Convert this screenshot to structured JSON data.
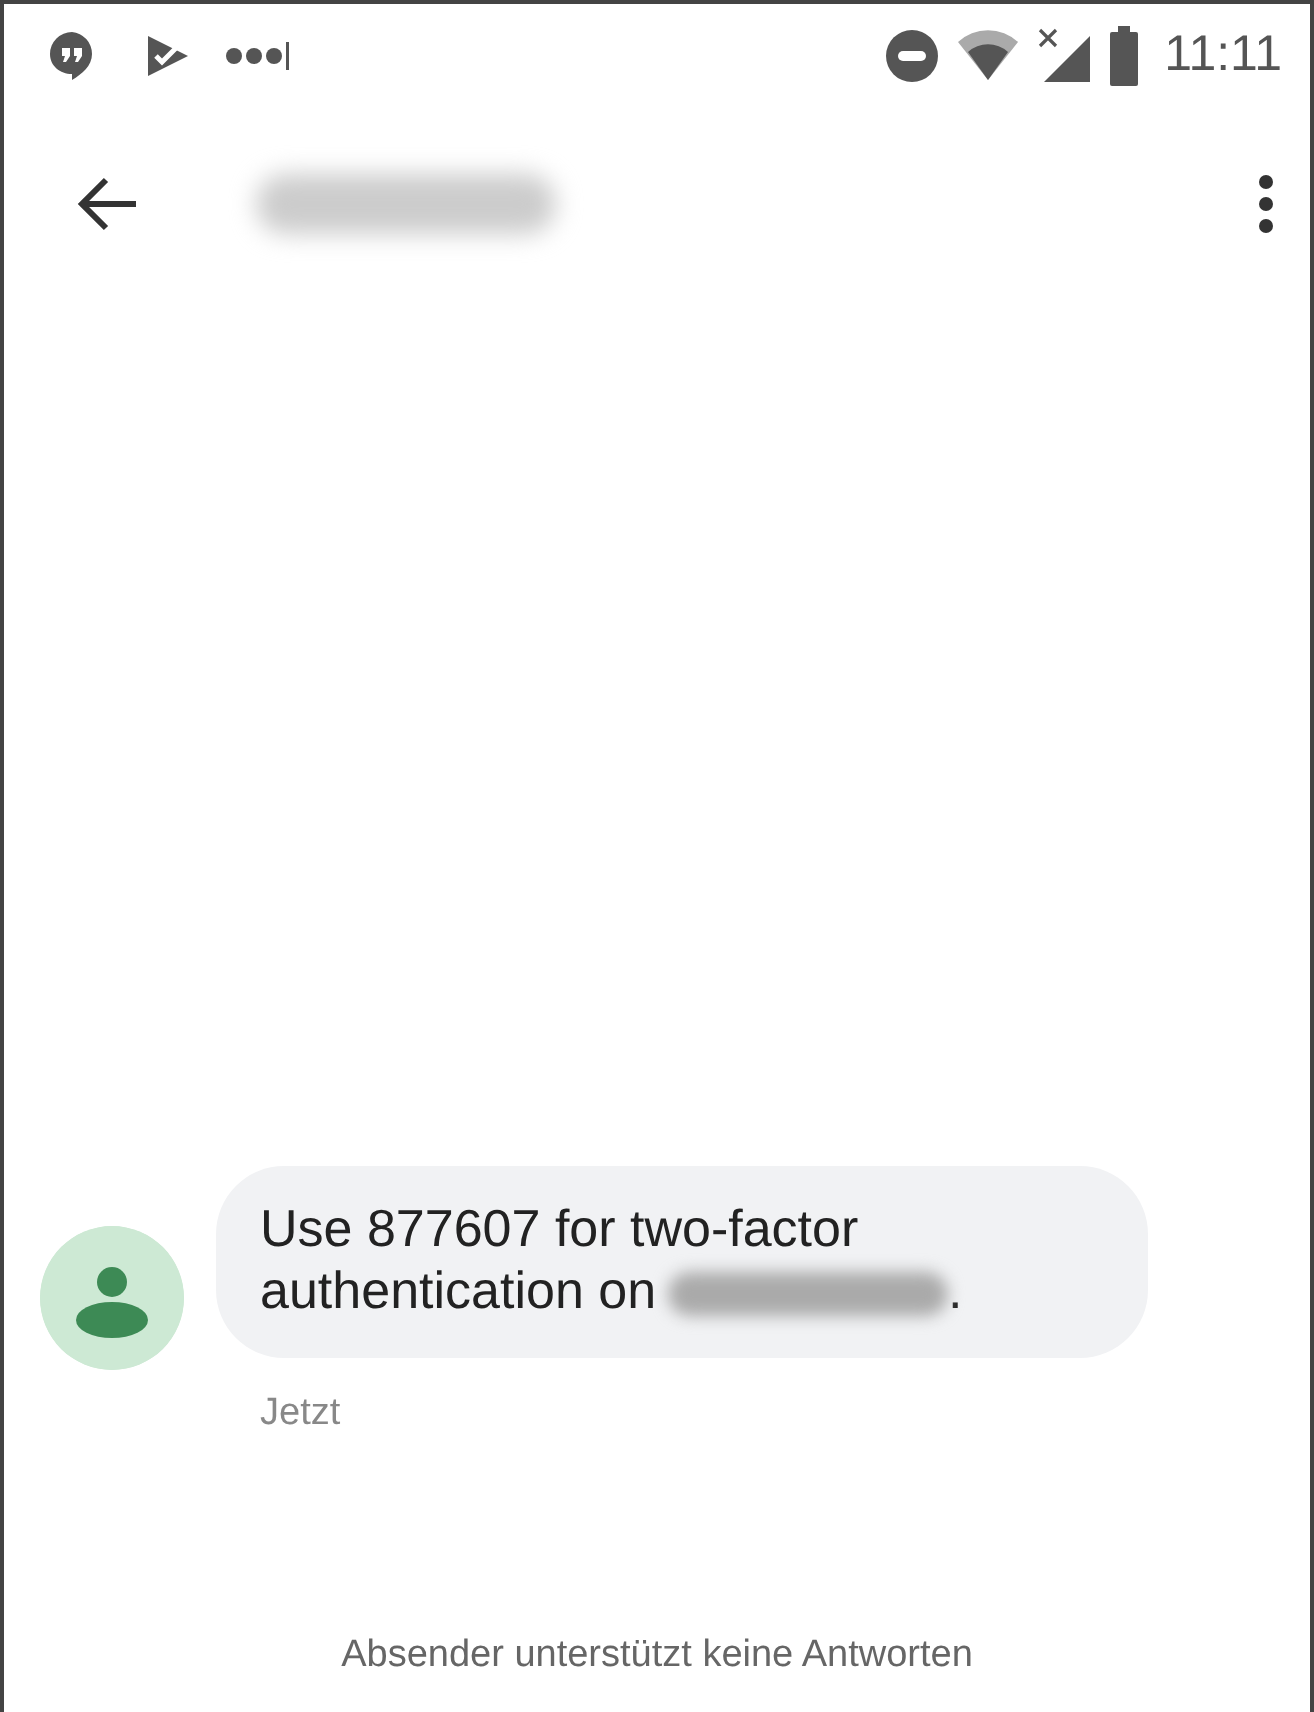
{
  "status_bar": {
    "time": "11:11"
  },
  "message": {
    "text": "Use 877607 for two-factor authentication on",
    "text_end": ".",
    "timestamp": "Jetzt"
  },
  "footer": {
    "notice": "Absender unterstützt keine Antworten"
  }
}
